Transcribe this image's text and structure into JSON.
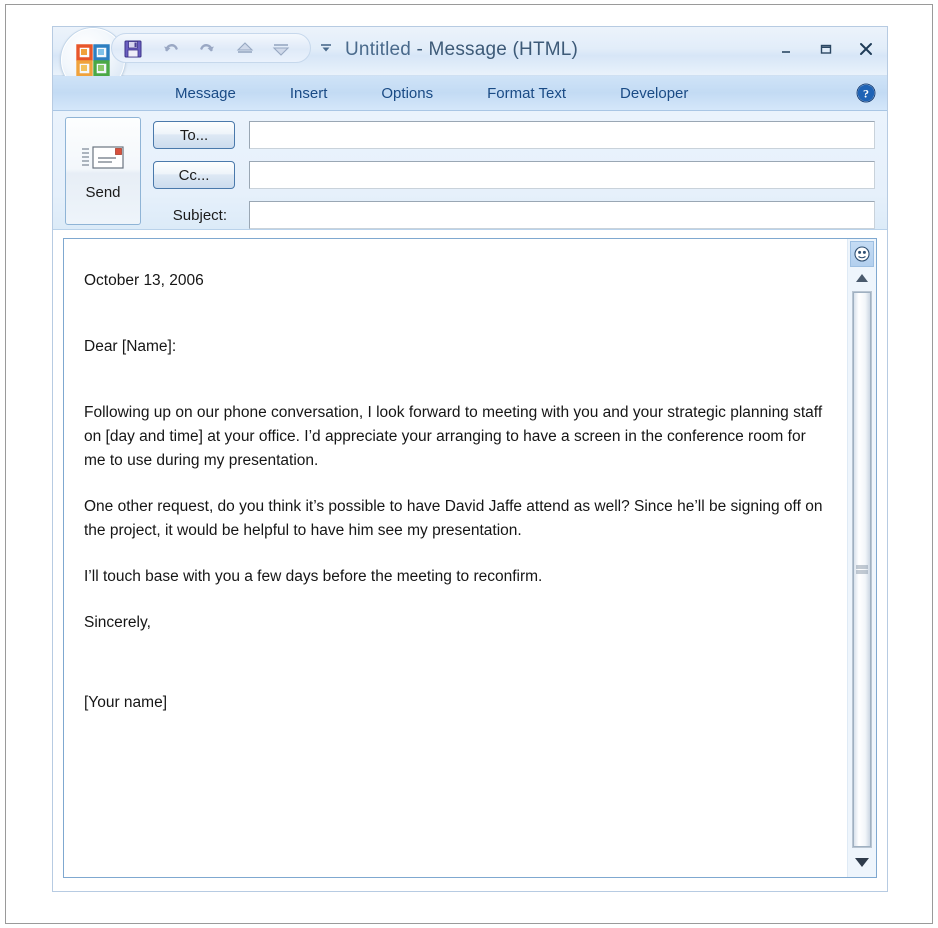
{
  "window": {
    "title_primary": "Untitled",
    "title_separator": " - ",
    "title_secondary": "Message (HTML)",
    "minimize_label": "–",
    "maximize_label": "▭",
    "close_label": "✕",
    "accent_color": "#1a4b85",
    "titlebar_color": "#e2edf9",
    "tabstrip_color": "#c3dbf4"
  },
  "quick_access_toolbar": {
    "office_button": "office-orb",
    "buttons": [
      {
        "name": "save-icon",
        "label": "Save",
        "enabled": true
      },
      {
        "name": "undo-icon",
        "label": "Undo",
        "enabled": false
      },
      {
        "name": "redo-icon",
        "label": "Redo",
        "enabled": false
      },
      {
        "name": "previous-item-icon",
        "label": "Previous Item",
        "enabled": false
      },
      {
        "name": "next-item-icon",
        "label": "Next Item",
        "enabled": false
      }
    ],
    "customize_label": "Customize Quick Access Toolbar"
  },
  "ribbon": {
    "tabs": [
      {
        "label": "Message",
        "active": true
      },
      {
        "label": "Insert",
        "active": false
      },
      {
        "label": "Options",
        "active": false
      },
      {
        "label": "Format Text",
        "active": false
      },
      {
        "label": "Developer",
        "active": false
      }
    ],
    "help_label": "?"
  },
  "compose": {
    "send_label": "Send",
    "to_label": "To...",
    "cc_label": "Cc...",
    "subject_label": "Subject:",
    "to_value": "",
    "cc_value": "",
    "subject_value": "",
    "to_placeholder": "",
    "cc_placeholder": "",
    "subject_placeholder": ""
  },
  "message_body": {
    "date": "October 13, 2006",
    "salutation": "Dear [Name]:",
    "paragraph_1": "Following up on our phone conversation, I look forward to meeting with you and your strategic planning staff on [day and time] at your office. I’d appreciate your arranging to have a screen in the conference room for me to use during my presentation.",
    "paragraph_2": "One other request, do you think it’s possible to have David Jaffe attend as well? Since he’ll be signing off on the project, it would be helpful to have him see my presentation.",
    "paragraph_3": "I’ll touch base with you a few days before the meeting to reconfirm.",
    "closing": "Sincerely,",
    "signature": "[Your name]"
  },
  "scrollbar": {
    "select_browse_object_label": "Select Browse Object",
    "scroll_up_label": "▲",
    "scroll_down_label": "▼",
    "thumb_position_percent": 0
  }
}
